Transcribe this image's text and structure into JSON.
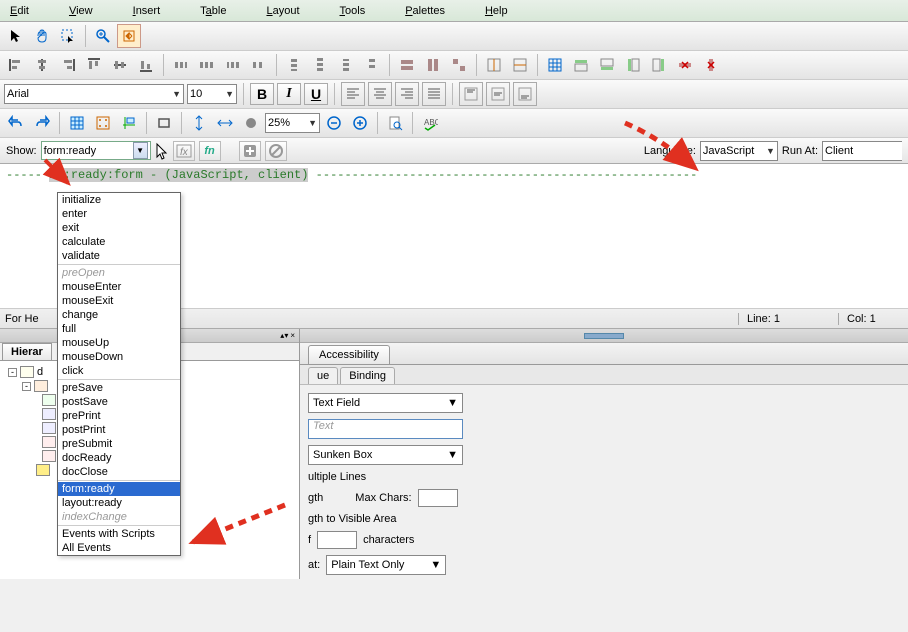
{
  "menu": {
    "edit": "Edit",
    "view": "View",
    "insert": "Insert",
    "table": "Table",
    "layout": "Layout",
    "tools": "Tools",
    "palettes": "Palettes",
    "help": "Help"
  },
  "font": {
    "name": "Arial",
    "size": "10"
  },
  "zoom": "25%",
  "script": {
    "show_label": "Show:",
    "show_value": "form:ready",
    "language_label": "Language:",
    "language_value": "JavaScript",
    "runat_label": "Run At:",
    "runat_value": "Client",
    "code_line": "1::ready:form - (JavaScript, client)"
  },
  "events": [
    "initialize",
    "enter",
    "exit",
    "calculate",
    "validate",
    "",
    "preOpen",
    "mouseEnter",
    "mouseExit",
    "change",
    "full",
    "mouseUp",
    "mouseDown",
    "click",
    "",
    "preSave",
    "postSave",
    "prePrint",
    "postPrint",
    "preSubmit",
    "docReady",
    "docClose",
    "",
    "form:ready",
    "layout:ready",
    "indexChange",
    "",
    "Events with Scripts",
    "All Events"
  ],
  "events_disabled": [
    "preOpen",
    "indexChange"
  ],
  "events_selected": "form:ready",
  "status": {
    "help": "For He",
    "line": "Line: 1",
    "col": "Col: 1"
  },
  "hierarchy": {
    "tab": "Hierar",
    "root": "d"
  },
  "props": {
    "tab_access": "Accessibility",
    "tab_value": "ue",
    "tab_binding": "Binding",
    "type_value": "Text Field",
    "caption_placeholder": "Text",
    "appearance_value": "Sunken Box",
    "multiline": "ultiple Lines",
    "length": "gth",
    "maxchars": "Max Chars:",
    "limit": "gth to Visible Area",
    "of": "f",
    "characters": "characters",
    "format_label": "at:",
    "format_value": "Plain Text Only"
  }
}
